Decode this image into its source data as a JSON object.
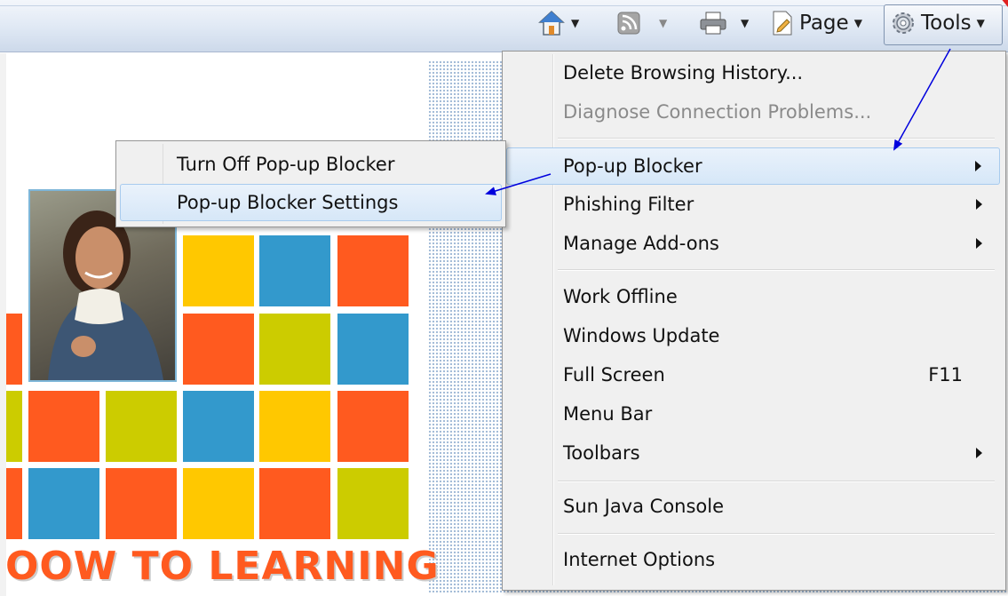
{
  "toolbar": {
    "page_label": "Page",
    "tools_label": "Tools"
  },
  "tools_menu": {
    "items": [
      {
        "label": "Delete Browsing History..."
      },
      {
        "label": "Diagnose Connection Problems..."
      },
      {
        "label": "Pop-up Blocker"
      },
      {
        "label": "Phishing Filter"
      },
      {
        "label": "Manage Add-ons"
      },
      {
        "label": "Work Offline"
      },
      {
        "label": "Windows Update"
      },
      {
        "label": "Full Screen",
        "shortcut": "F11"
      },
      {
        "label": "Menu Bar"
      },
      {
        "label": "Toolbars"
      },
      {
        "label": "Sun Java Console"
      },
      {
        "label": "Internet Options"
      }
    ]
  },
  "popup_submenu": {
    "items": [
      {
        "label": "Turn Off Pop-up Blocker"
      },
      {
        "label": "Pop-up Blocker Settings"
      }
    ]
  },
  "page": {
    "logo_text": "OOW TO LEARNING"
  },
  "colors": {
    "orange": "#ff5a1f",
    "yellow": "#ffc800",
    "blue": "#3399cc",
    "olive": "#cccc00",
    "arrow": "#0000dd"
  },
  "icons": [
    "home-icon",
    "rss-feed-icon",
    "print-icon",
    "page-icon",
    "gear-icon"
  ]
}
